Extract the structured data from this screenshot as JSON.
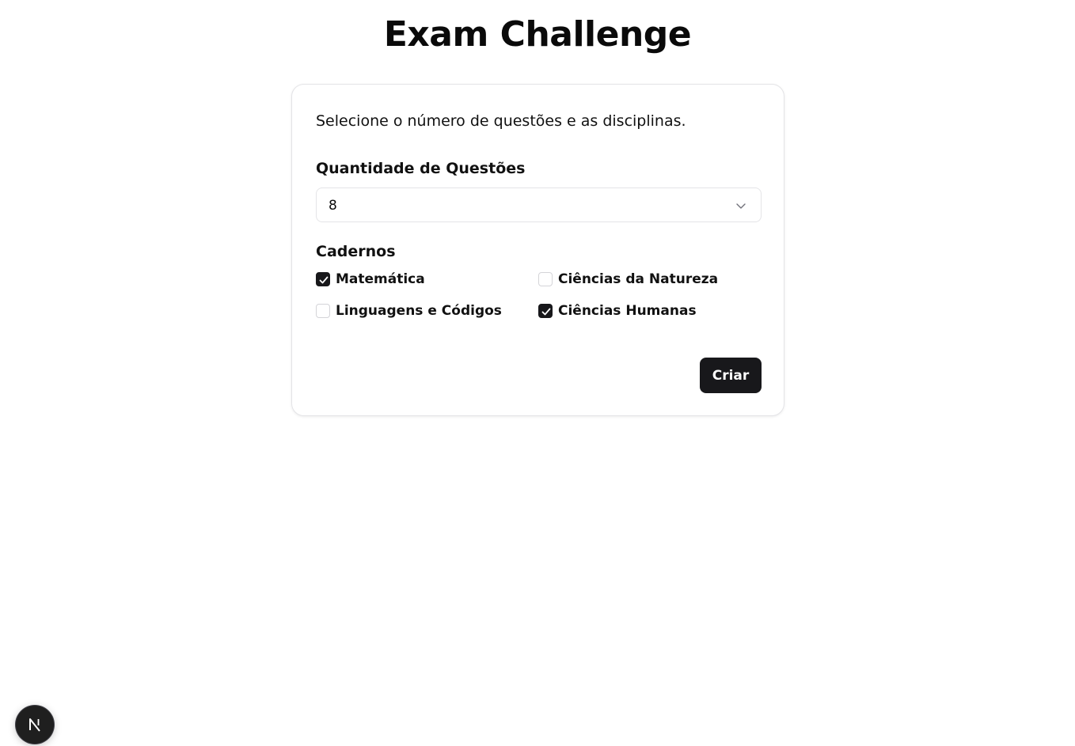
{
  "header": {
    "title": "Exam Challenge"
  },
  "form": {
    "description": "Selecione o número de questões e as disciplinas.",
    "quantity": {
      "label": "Quantidade de Questões",
      "selected_value": "8",
      "icon": "chevron-down-icon"
    },
    "notebooks": {
      "label": "Cadernos",
      "options": [
        {
          "label": "Matemática",
          "checked": true
        },
        {
          "label": "Ciências da Natureza",
          "checked": false
        },
        {
          "label": "Linguagens e Códigos",
          "checked": false
        },
        {
          "label": "Ciências Humanas",
          "checked": true
        }
      ]
    },
    "submit_label": "Criar"
  },
  "dev_badge": {
    "icon": "nextjs-logo-icon",
    "letter": "N"
  },
  "colors": {
    "primary": "#18181b",
    "border": "#e4e4e7",
    "text": "#0a0a0a",
    "background": "#ffffff"
  }
}
